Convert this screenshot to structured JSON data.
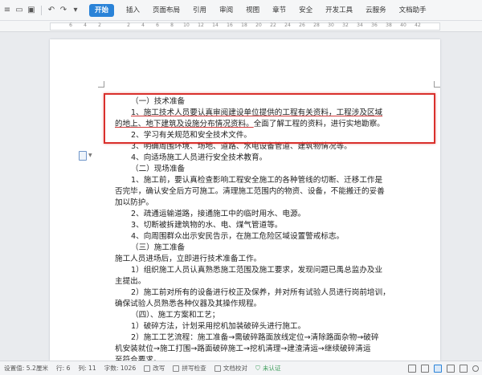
{
  "ribbon": {
    "quick_access": [
      "menu-icon",
      "folder-icon",
      "undo-icon",
      "redo-icon",
      "more-icon"
    ],
    "tabs": [
      "开始",
      "插入",
      "页面布局",
      "引用",
      "审阅",
      "视图",
      "章节",
      "安全",
      "开发工具",
      "云服务",
      "文档助手"
    ],
    "active_tab_color": "#2a83d8"
  },
  "ruler": {
    "ticks": [
      "6",
      "4",
      "2",
      "2",
      "4",
      "6",
      "8",
      "10",
      "12",
      "14",
      "16",
      "18",
      "20",
      "22",
      "24",
      "26",
      "28",
      "30",
      "32",
      "34",
      "36",
      "38",
      "40",
      "42"
    ]
  },
  "document": {
    "lines": [
      "（一）技术准备",
      "1、施工技术人员要认真审阅建设单位提供的工程有关资料，工程涉及区域",
      "的地上、地下建筑及设施分布情况资料。全面了解工程的资料，进行实地勘察。",
      "2、学习有关规范和安全技术文件。",
      "3、明确周围环境、场地、道路、水电设备管道、建筑物情况等。",
      "4、向适场施工人员进行安全技术教育。",
      "（二）现场准备",
      "1、施工前，要认真检查影响工程安全施工的各种管线的切断、迁移工作是",
      "否完毕，确认安全后方可施工。清理施工范围内的物资、设备，不能搬迁的妥善",
      "加以防护。",
      "2、疏通运输道路，接通施工中的临时用水、电源。",
      "3、切断被拆建筑物的水、电、煤气管道等。",
      "4、向周围群众出示安民告示，在施工危险区域设置警戒标志。",
      "（三）施工准备",
      "施工人员进场后，立即进行技术准备工作。",
      "1）组织施工人员认真熟悉施工范围及施工要求，发现问题已禹总监办及业",
      "主提出。",
      "2）施工前对所有的设备进行校正及保养，并对所有试验人员进行岗前培训，",
      "确保试验人员熟悉各种仪器及其操作规程。",
      "（四）、施工方案和工艺；",
      "1）破碎方法，计划采用挖机加装破碎头进行施工。",
      "2）施工工艺流程：施工准备→需破碎路面放线定位→清除路面杂物→破碎",
      "机安装就位→施工打围→路面破碎施工→挖机清理→建渣清运→继续破碎清运",
      "至符合要求。"
    ],
    "highlight_color": "#d9302c"
  },
  "status": {
    "position": "设置值: 5.2厘米",
    "row": "行: 6",
    "col": "列: 11",
    "word_count": "字数: 1026",
    "revision": "改写",
    "spell_check": "拼写检查",
    "doc_proof": "文档校对",
    "cert": "未认证"
  }
}
